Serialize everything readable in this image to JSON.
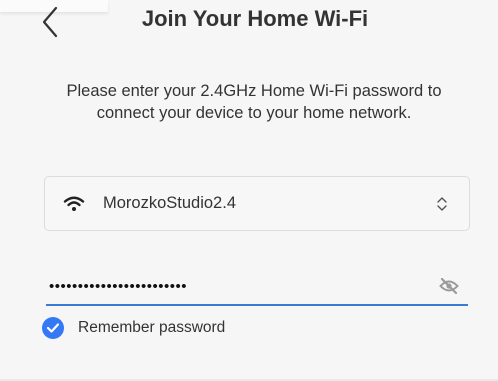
{
  "header": {
    "title": "Join Your Home Wi-Fi",
    "back_icon": "chevron-left-icon"
  },
  "instructions": "Please enter your 2.4GHz Home Wi-Fi password to connect your device to your home network.",
  "network": {
    "selected": "MorozkoStudio2.4",
    "icon": "wifi-icon",
    "chevron_icon": "chevron-up-down-icon"
  },
  "password": {
    "value": "••••••••••••••••••••••••",
    "toggle_icon": "eye-off-icon",
    "focus_color": "#3a7bd5"
  },
  "remember": {
    "label": "Remember password",
    "checked": true,
    "color": "#3478f6"
  }
}
